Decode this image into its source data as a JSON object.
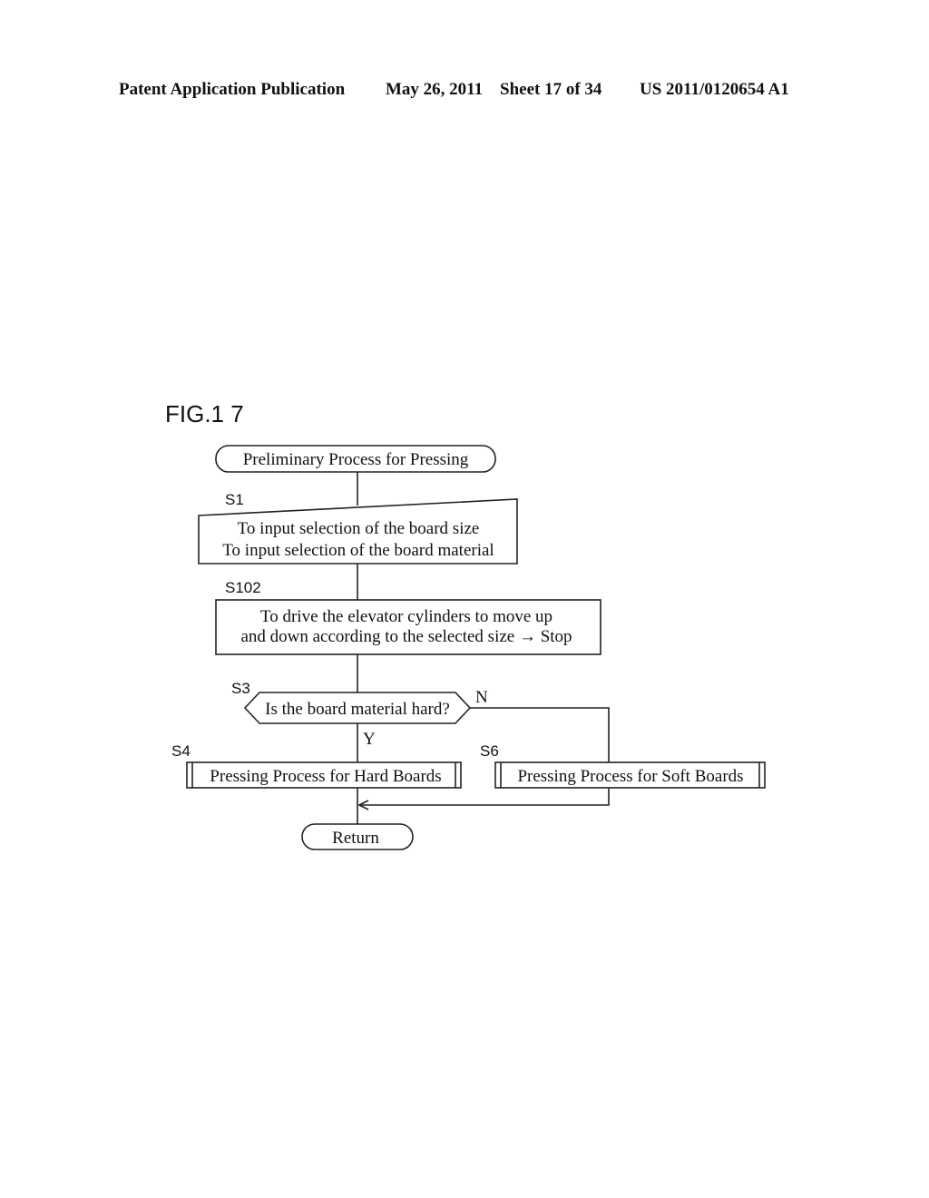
{
  "header": {
    "publication": "Patent Application Publication",
    "date": "May 26, 2011",
    "sheet": "Sheet 17 of 34",
    "number": "US 2011/0120654 A1"
  },
  "figure": {
    "label": "FIG.1 7",
    "start": "Preliminary Process for Pressing",
    "steps": {
      "s1": {
        "id": "S1",
        "lines": [
          "To input selection of the board size",
          "To input selection of the board material"
        ]
      },
      "s102": {
        "id": "S102",
        "lines": [
          "To drive the elevator cylinders to move up",
          "and down according to the selected size → Stop"
        ]
      },
      "s3": {
        "id": "S3",
        "question": "Is the board material hard?",
        "yes_label": "Y",
        "no_label": "N"
      },
      "s4": {
        "id": "S4",
        "text": "Pressing Process for Hard Boards"
      },
      "s6": {
        "id": "S6",
        "text": "Pressing Process for Soft Boards"
      }
    },
    "end": "Return"
  }
}
